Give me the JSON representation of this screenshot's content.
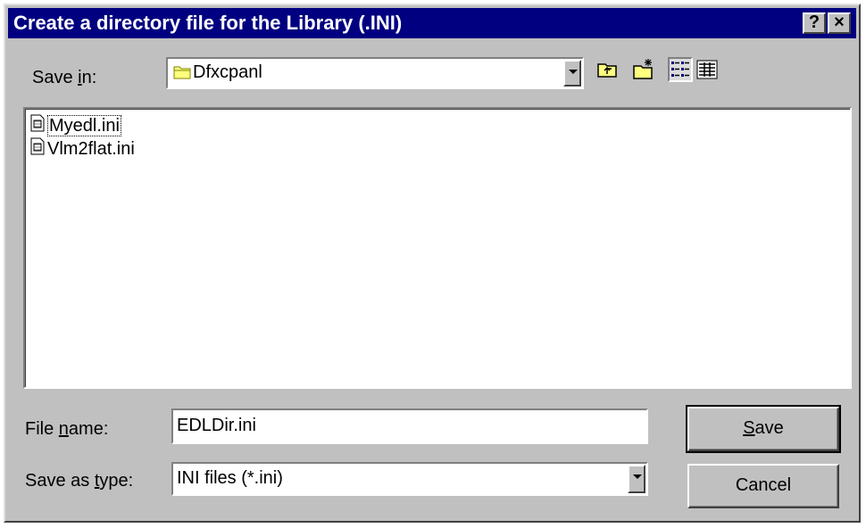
{
  "dialog": {
    "title": "Create a directory file for the Library (.INI)"
  },
  "save_in": {
    "label_pre": "Save ",
    "label_key": "i",
    "label_post": "n:",
    "folder_icon": "folder-icon",
    "value": "Dfxcpanl"
  },
  "files": [
    {
      "name": "Myedl.ini",
      "icon": "ini-file-icon"
    },
    {
      "name": "Vlm2flat.ini",
      "icon": "ini-file-icon"
    }
  ],
  "file_name": {
    "label_pre": "File ",
    "label_key": "n",
    "label_post": "ame:",
    "value": "EDLDir.ini"
  },
  "save_as_type": {
    "label_pre": "Save as ",
    "label_key": "t",
    "label_post": "ype:",
    "value": "INI files (*.ini)"
  },
  "buttons": {
    "save_key": "S",
    "save_rest": "ave",
    "cancel": "Cancel",
    "help": "?",
    "close": "×"
  },
  "colors": {
    "titlebar": "#000080",
    "face": "#c0c0c0"
  }
}
